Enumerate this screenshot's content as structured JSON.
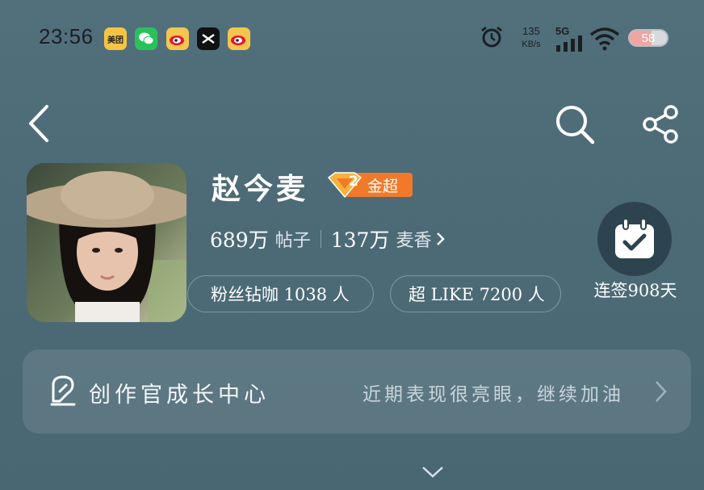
{
  "status_bar": {
    "time": "23:56",
    "apps": [
      {
        "icon": "meituan-icon",
        "label": "美团",
        "color": "#f6c443"
      },
      {
        "icon": "wechat-icon",
        "label": "",
        "color": "#2bc15a"
      },
      {
        "icon": "weibo-icon",
        "label": "",
        "color": "#f4c64e"
      },
      {
        "icon": "capcut-icon",
        "label": "",
        "color": "#111111"
      },
      {
        "icon": "weibo-icon",
        "label": "",
        "color": "#f4c64e"
      }
    ],
    "net_speed_value": "135",
    "net_speed_unit": "KB/s",
    "network": "5G",
    "battery": "58"
  },
  "nav": {
    "back_icon": "back-arrow-icon",
    "search_icon": "search-icon",
    "share_icon": "share-icon"
  },
  "profile": {
    "name": "赵今麦",
    "badge_label": "金超",
    "badge_level": "2",
    "posts_count": "689万",
    "posts_label": "帖子",
    "fans_count": "137万",
    "fans_label": "麦香",
    "pill_diamond": "粉丝钻咖 1038 人",
    "pill_like": "超 LIKE 7200 人",
    "checkin_label": "连签908天"
  },
  "creator": {
    "title": "创作官成长中心",
    "subtitle": "近期表现很亮眼，继续加油"
  },
  "colors": {
    "background": "#4f6d79",
    "badge_orange": "#f07a2a"
  }
}
